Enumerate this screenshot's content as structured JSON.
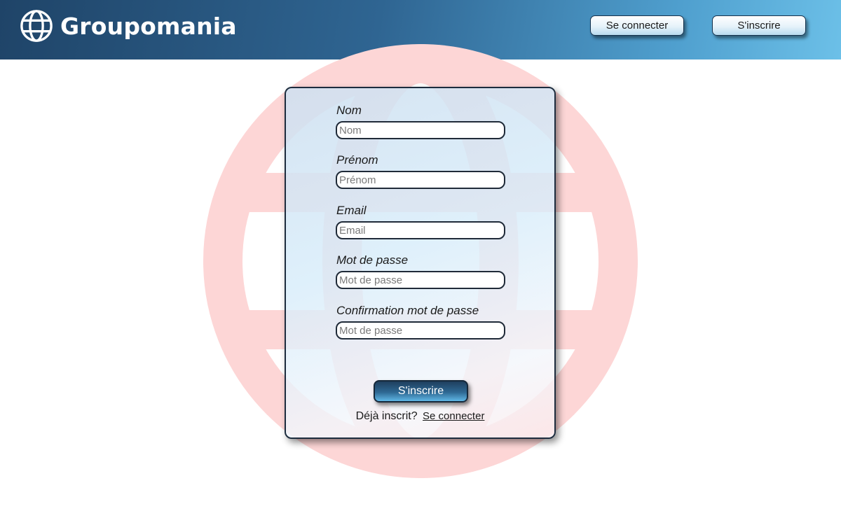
{
  "header": {
    "brand": "Groupomania",
    "login_button": "Se connecter",
    "signup_button": "S'inscrire"
  },
  "form": {
    "fields": [
      {
        "label": "Nom",
        "placeholder": "Nom",
        "value": ""
      },
      {
        "label": "Prénom",
        "placeholder": "Prénom",
        "value": ""
      },
      {
        "label": "Email",
        "placeholder": "Email",
        "value": ""
      },
      {
        "label": "Mot de passe",
        "placeholder": "Mot de passe",
        "value": ""
      },
      {
        "label": "Confirmation mot de passe",
        "placeholder": "Mot de passe",
        "value": ""
      }
    ],
    "submit_label": "S'inscrire",
    "already_text": "Déjà inscrit?",
    "login_link": "Se connecter"
  },
  "icons": {
    "brand_logo": "globe-icon",
    "background_logo": "globe-icon"
  },
  "colors": {
    "header_start": "#1f4468",
    "header_end": "#6cc0e8",
    "background_logo": "#fdd6d6",
    "border": "#1d2c3e"
  }
}
